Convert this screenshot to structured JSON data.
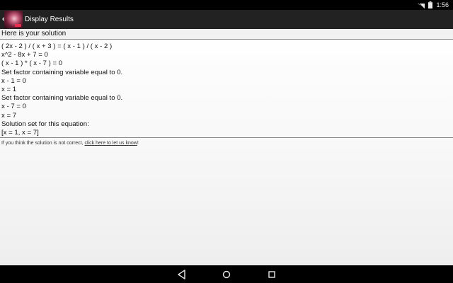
{
  "status_bar": {
    "time": "1:56"
  },
  "action_bar": {
    "title": "Display Results"
  },
  "solution": {
    "header": "Here is your solution",
    "steps": [
      "( 2x - 2 ) / ( x + 3 ) = ( x - 1 ) / ( x - 2 )",
      "x^2 - 8x + 7 = 0",
      "( x - 1 ) * ( x - 7 ) = 0",
      "Set factor containing variable equal to 0.",
      "x - 1 = 0",
      "x = 1",
      "Set factor containing variable equal to 0.",
      "x - 7 = 0",
      "x = 7",
      "Solution set for this equation:",
      "[x = 1, x = 7]"
    ]
  },
  "report": {
    "prefix": "If you think the solution is not correct, ",
    "link_text": "click here to let us know",
    "suffix": "!"
  },
  "icons": {
    "wifi": "wifi-icon",
    "battery": "battery-icon",
    "back": "back-chevron-icon",
    "app": "app-icon",
    "nav_back": "nav-back-icon",
    "nav_home": "nav-home-icon",
    "nav_recents": "nav-recents-icon"
  },
  "colors": {
    "action_bar": "#222222",
    "status_bar": "#000000",
    "nav_bar": "#000000",
    "content_bg": "#ffffff",
    "divider": "#8a8a8a"
  }
}
